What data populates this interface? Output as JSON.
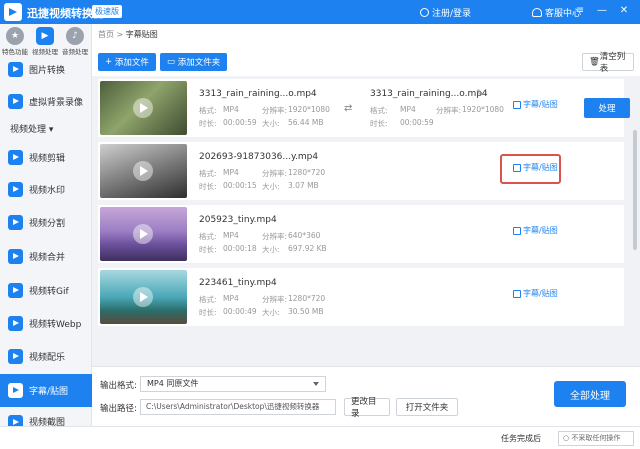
{
  "app": {
    "title": "迅捷视频转换器",
    "edition": "极速版",
    "login": "注册/登录",
    "service": "客服中心",
    "controls": {
      "menu": "≡",
      "minimize": "—",
      "close": "✕"
    }
  },
  "sidebar": {
    "top_items": [
      {
        "label": "特色功能",
        "icon": "star-icon"
      },
      {
        "label": "视频处理",
        "icon": "film-icon"
      },
      {
        "label": "音频处理",
        "icon": "music-icon"
      }
    ],
    "items": [
      {
        "label": "图片转换"
      },
      {
        "label": "虚拟背景录像"
      },
      {
        "label": "视频剪辑"
      },
      {
        "label": "视频水印"
      },
      {
        "label": "视频分割"
      },
      {
        "label": "视频合并"
      },
      {
        "label": "视频转Gif"
      },
      {
        "label": "视频转Webp"
      },
      {
        "label": "视频配乐"
      },
      {
        "label": "字幕/贴图"
      },
      {
        "label": "视频截图"
      }
    ],
    "section_label": "视频处理"
  },
  "breadcrumb": {
    "home": "首页",
    "sep": ">",
    "current": "字幕贴图"
  },
  "toolbar": {
    "add_file": "添加文件",
    "add_folder": "添加文件夹",
    "clear": "清空列表"
  },
  "files": [
    {
      "name": "3313_rain_raining...o.mp4",
      "format": "MP4",
      "resolution": "1920*1080",
      "duration": "00:00:59",
      "size": "56.44 MB",
      "out_name": "3313_rain_raining...o.mp4",
      "out_format": "MP4",
      "out_resolution": "1920*1080",
      "out_duration": "00:00:59",
      "sub_label": "字幕/贴图",
      "process_label": "处理"
    },
    {
      "name": "202693-91873036...y.mp4",
      "format": "MP4",
      "resolution": "1280*720",
      "duration": "00:00:15",
      "size": "3.07 MB",
      "sub_label": "字幕/贴图"
    },
    {
      "name": "205923_tiny.mp4",
      "format": "MP4",
      "resolution": "640*360",
      "duration": "00:00:18",
      "size": "697.92 KB",
      "sub_label": "字幕/贴图"
    },
    {
      "name": "223461_tiny.mp4",
      "format": "MP4",
      "resolution": "1280*720",
      "duration": "00:00:49",
      "size": "30.50 MB",
      "sub_label": "字幕/贴图"
    }
  ],
  "meta_labels": {
    "format": "格式:",
    "resolution": "分辨率:",
    "duration": "时长:",
    "size": "大小:"
  },
  "bottom": {
    "output_format_label": "输出格式:",
    "output_format_value": "MP4  同原文件",
    "output_path_label": "输出路径:",
    "output_path_value": "C:\\Users\\Administrator\\Desktop\\迅捷视频转换器",
    "change_dir": "更改目录",
    "open_folder": "打开文件夹",
    "process_all": "全部处理"
  },
  "footer": {
    "after_done_label": "任务完成后",
    "after_done_value": "○ 不采取任何操作"
  },
  "colors": {
    "accent": "#1d82ef",
    "highlight": "#d9534f"
  }
}
